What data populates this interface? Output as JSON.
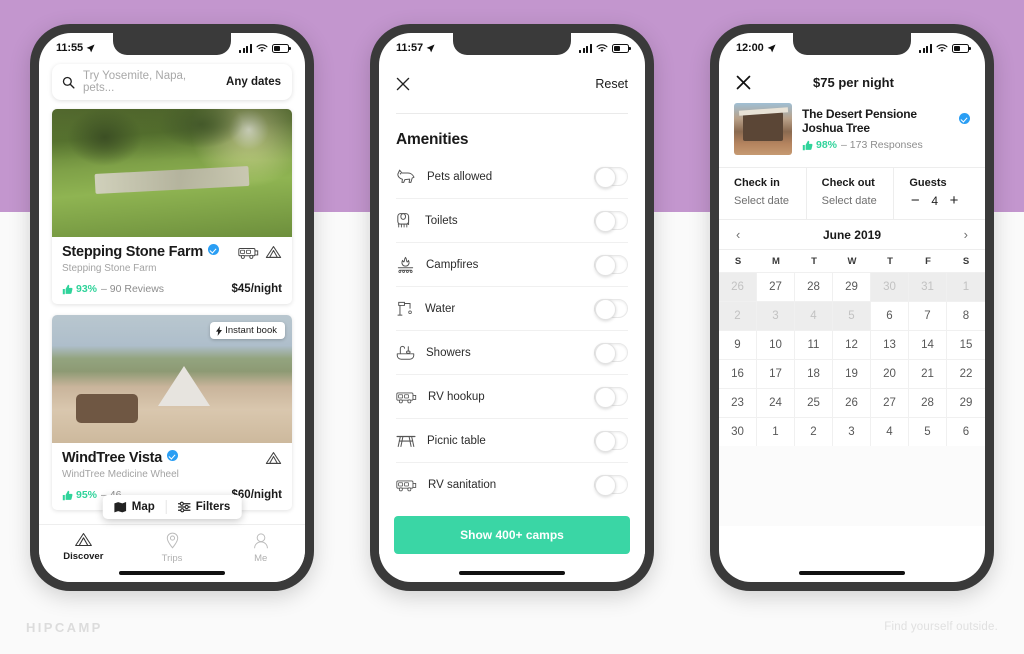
{
  "backdrop": {
    "purple": "#c396ce",
    "grey": "#fafafa"
  },
  "footer": {
    "brand": "HIPCAMP",
    "tagline": "Find yourself outside."
  },
  "phone1": {
    "status": {
      "time": "11:55",
      "location_icon": "location-arrow-icon",
      "signal_icon": "cellular-bars-icon",
      "wifi_icon": "wifi-icon",
      "battery_icon": "battery-icon"
    },
    "search": {
      "icon": "search-icon",
      "placeholder": "Try Yosemite, Napa, pets...",
      "dates_label": "Any dates"
    },
    "listings": [
      {
        "title": "Stepping Stone Farm",
        "verified_icon": "verified-badge-icon",
        "subtitle": "Stepping Stone Farm",
        "rating_icon": "thumbs-up-icon",
        "rating": "93%",
        "reviews": "– 90 Reviews",
        "price": "$45/night",
        "type_icons": [
          "rv-icon",
          "tent-icon"
        ],
        "instant_book": null
      },
      {
        "title": "WindTree Vista",
        "verified_icon": "verified-badge-icon",
        "subtitle": "WindTree Medicine Wheel",
        "rating_icon": "thumbs-up-icon",
        "rating": "95%",
        "reviews": "– 46",
        "price": "$60/night",
        "type_icons": [
          "tent-icon"
        ],
        "instant_book": {
          "icon": "lightning-bolt-icon",
          "label": "Instant book"
        }
      }
    ],
    "floating": {
      "map": {
        "icon": "map-icon",
        "label": "Map"
      },
      "filters": {
        "icon": "filters-sliders-icon",
        "label": "Filters"
      }
    },
    "tabs": [
      {
        "icon": "tent-icon",
        "label": "Discover",
        "active": true
      },
      {
        "icon": "map-pin-icon",
        "label": "Trips",
        "active": false
      },
      {
        "icon": "person-icon",
        "label": "Me",
        "active": false
      }
    ]
  },
  "phone2": {
    "status": {
      "time": "11:57"
    },
    "header": {
      "close_icon": "close-x-icon",
      "reset_label": "Reset"
    },
    "section_title": "Amenities",
    "amenities": [
      {
        "icon": "dog-icon",
        "label": "Pets allowed",
        "on": false
      },
      {
        "icon": "toilet-paper-icon",
        "label": "Toilets",
        "on": false
      },
      {
        "icon": "campfire-icon",
        "label": "Campfires",
        "on": false
      },
      {
        "icon": "faucet-icon",
        "label": "Water",
        "on": false
      },
      {
        "icon": "bathtub-icon",
        "label": "Showers",
        "on": false
      },
      {
        "icon": "rv-icon",
        "label": "RV hookup",
        "on": false
      },
      {
        "icon": "picnic-table-icon",
        "label": "Picnic table",
        "on": false
      },
      {
        "icon": "rv-icon",
        "label": "RV sanitation",
        "on": false
      }
    ],
    "cta": {
      "label": "Show 400+ camps",
      "color": "#3ad6a5"
    }
  },
  "phone3": {
    "status": {
      "time": "12:00"
    },
    "header": {
      "close_icon": "close-x-icon",
      "title": "$75 per night"
    },
    "listing": {
      "name": "The Desert Pensione Joshua Tree",
      "verified_icon": "verified-badge-icon",
      "rating_icon": "thumbs-up-icon",
      "rating": "98%",
      "responses": "– 173 Responses"
    },
    "fields": {
      "checkin": {
        "label": "Check in",
        "value": "Select date"
      },
      "checkout": {
        "label": "Check out",
        "value": "Select date"
      },
      "guests": {
        "label": "Guests",
        "minus": "−",
        "value": "4",
        "plus": "+"
      }
    },
    "calendar": {
      "prev_icon": "chevron-left-icon",
      "next_icon": "chevron-right-icon",
      "month": "June 2019",
      "dow": [
        "S",
        "M",
        "T",
        "W",
        "T",
        "F",
        "S"
      ],
      "cells": [
        {
          "d": "26",
          "dim": true
        },
        {
          "d": "27",
          "dim": false
        },
        {
          "d": "28",
          "dim": false
        },
        {
          "d": "29",
          "dim": false
        },
        {
          "d": "30",
          "dim": true
        },
        {
          "d": "31",
          "dim": true
        },
        {
          "d": "1",
          "dim": true
        },
        {
          "d": "2",
          "dim": true
        },
        {
          "d": "3",
          "dim": true
        },
        {
          "d": "4",
          "dim": true
        },
        {
          "d": "5",
          "dim": true
        },
        {
          "d": "6",
          "dim": false
        },
        {
          "d": "7",
          "dim": false
        },
        {
          "d": "8",
          "dim": false
        },
        {
          "d": "9",
          "dim": false
        },
        {
          "d": "10",
          "dim": false
        },
        {
          "d": "11",
          "dim": false
        },
        {
          "d": "12",
          "dim": false
        },
        {
          "d": "13",
          "dim": false
        },
        {
          "d": "14",
          "dim": false
        },
        {
          "d": "15",
          "dim": false
        },
        {
          "d": "16",
          "dim": false
        },
        {
          "d": "17",
          "dim": false
        },
        {
          "d": "18",
          "dim": false
        },
        {
          "d": "19",
          "dim": false
        },
        {
          "d": "20",
          "dim": false
        },
        {
          "d": "21",
          "dim": false
        },
        {
          "d": "22",
          "dim": false
        },
        {
          "d": "23",
          "dim": false
        },
        {
          "d": "24",
          "dim": false
        },
        {
          "d": "25",
          "dim": false
        },
        {
          "d": "26",
          "dim": false
        },
        {
          "d": "27",
          "dim": false
        },
        {
          "d": "28",
          "dim": false
        },
        {
          "d": "29",
          "dim": false
        },
        {
          "d": "30",
          "dim": false
        },
        {
          "d": "1",
          "dim": false
        },
        {
          "d": "2",
          "dim": false
        },
        {
          "d": "3",
          "dim": false
        },
        {
          "d": "4",
          "dim": false
        },
        {
          "d": "5",
          "dim": false
        },
        {
          "d": "6",
          "dim": false
        }
      ]
    }
  }
}
